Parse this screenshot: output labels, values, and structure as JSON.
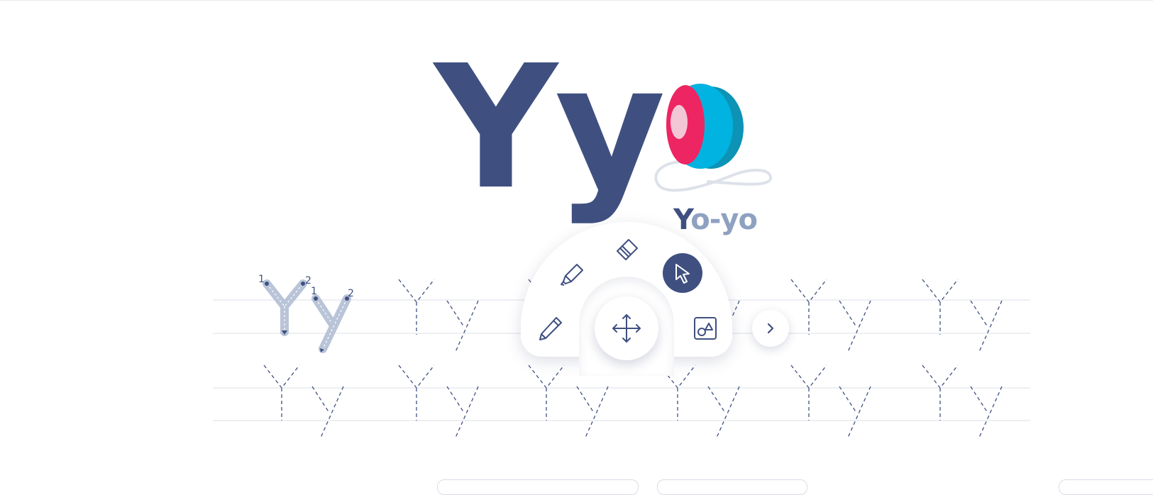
{
  "lesson": {
    "letter": "Yy",
    "word_first_letter": "Y",
    "word_rest": "o-yo",
    "picture": "yoyo-illustration",
    "stroke_numbers": [
      "1",
      "2",
      "1",
      "2"
    ]
  },
  "toolbar": {
    "tools": [
      "highlighter-icon",
      "eraser-icon",
      "cursor-icon",
      "pencil-icon",
      "move-icon",
      "shapes-icon",
      "chevron-right-icon"
    ],
    "active_tool": "cursor-icon"
  },
  "colors": {
    "primary": "#3f5080",
    "light_text": "#8fa1c0",
    "trace": "#b9c4d8",
    "guide_line": "#e2e5ec",
    "yoyo_blue": "#00b3e0",
    "yoyo_pink": "#ee2563"
  }
}
